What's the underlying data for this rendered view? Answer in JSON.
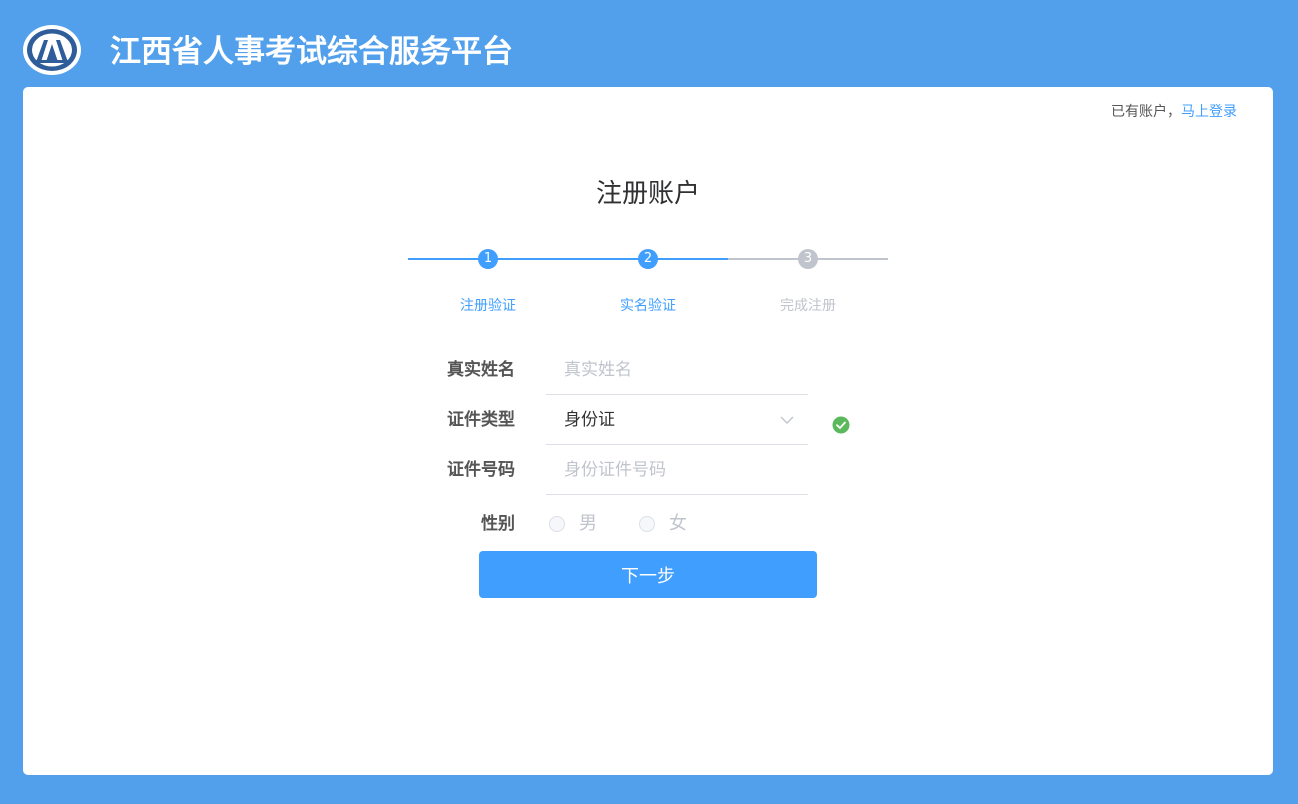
{
  "header": {
    "site_title": "江西省人事考试综合服务平台"
  },
  "login_hint": {
    "prefix": "已有账户，",
    "link_label": "马上登录"
  },
  "page_title": "注册账户",
  "steps": [
    {
      "number": "1",
      "label": "注册验证",
      "state": "done"
    },
    {
      "number": "2",
      "label": "实名验证",
      "state": "active"
    },
    {
      "number": "3",
      "label": "完成注册",
      "state": "pending"
    }
  ],
  "form": {
    "real_name": {
      "label": "真实姓名",
      "placeholder": "真实姓名",
      "value": ""
    },
    "id_type": {
      "label": "证件类型",
      "value": "身份证"
    },
    "id_number": {
      "label": "证件号码",
      "placeholder": "身份证件号码",
      "value": ""
    },
    "gender": {
      "label": "性别",
      "options": [
        "男",
        "女"
      ]
    }
  },
  "next_button_label": "下一步",
  "colors": {
    "background": "#52a0ec",
    "primary": "#409eff",
    "inactive": "#c0c4cc",
    "success": "#5cb85c"
  }
}
